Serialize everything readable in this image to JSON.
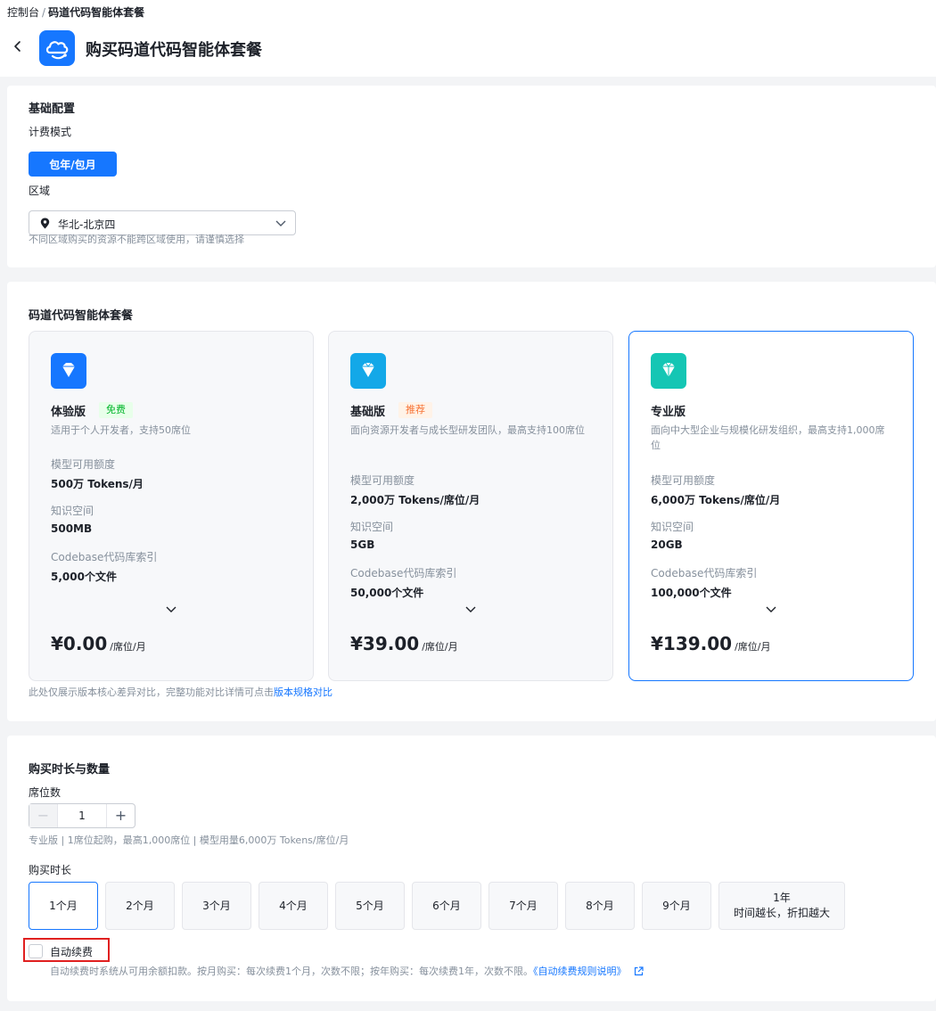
{
  "breadcrumb": {
    "root": "控制台",
    "sep": "/",
    "current": "码道代码智能体套餐"
  },
  "header": {
    "title": "购买码道代码智能体套餐"
  },
  "basic": {
    "title": "基础配置",
    "billing_label": "计费模式",
    "billing_value": "包年/包月",
    "region_label": "区域",
    "region_value": "华北-北京四",
    "region_hint": "不同区域购买的资源不能跨区域使用，请谨慎选择"
  },
  "plans_section": {
    "title": "码道代码智能体套餐",
    "compare_text": "此处仅展示版本核心差异对比，完整功能对比详情可点击",
    "compare_link": "版本规格对比",
    "plans": [
      {
        "name": "体验版",
        "badge": "免费",
        "desc": "适用于个人开发者，支持50席位",
        "k1": "模型可用额度",
        "v1": "500万 Tokens/月",
        "k2": "知识空间",
        "v2": "500MB",
        "k3": "Codebase代码库索引",
        "v3": "5,000个文件",
        "price": "¥0.00",
        "unit": "/席位/月",
        "icon_color": "#1677ff"
      },
      {
        "name": "基础版",
        "badge": "推荐",
        "desc": "面向资源开发者与成长型研发团队，最高支持100席位",
        "k1": "模型可用额度",
        "v1": "2,000万 Tokens/席位/月",
        "k2": "知识空间",
        "v2": "5GB",
        "k3": "Codebase代码库索引",
        "v3": "50,000个文件",
        "price": "¥39.00",
        "unit": "/席位/月",
        "icon_color": "#13a8e8"
      },
      {
        "name": "专业版",
        "badge": "",
        "desc": "面向中大型企业与规模化研发组织，最高支持1,000席位",
        "k1": "模型可用额度",
        "v1": "6,000万 Tokens/席位/月",
        "k2": "知识空间",
        "v2": "20GB",
        "k3": "Codebase代码库索引",
        "v3": "100,000个文件",
        "price": "¥139.00",
        "unit": "/席位/月",
        "icon_color": "#14c6b4"
      }
    ],
    "selected_plan": "专业版"
  },
  "purchase": {
    "title": "购买时长与数量",
    "seats_label": "席位数",
    "seats_value": "1",
    "seats_hint": "专业版 | 1席位起购，最高1,000席位 | 模型用量6,000万 Tokens/席位/月",
    "duration_label": "购买时长",
    "durations": [
      "1个月",
      "2个月",
      "3个月",
      "4个月",
      "5个月",
      "6个月",
      "7个月",
      "8个月",
      "9个月"
    ],
    "duration_year": "1年",
    "duration_year_note": "时间越长，折扣越大",
    "selected_duration": "1个月",
    "auto_renew_label": "自动续费",
    "auto_renew_checked": false,
    "auto_renew_hint": "自动续费时系统从可用余额扣款。按月购买：每次续费1个月，次数不限；按年购买：每次续费1年，次数不限。",
    "auto_renew_link": "《自动续费规则说明》"
  },
  "colors": {
    "accent": "#1677ff",
    "free_badge_bg": "#e8ffea",
    "free_badge_fg": "#00b42a",
    "rec_badge_bg": "#fff3e8",
    "rec_badge_fg": "#f77234",
    "highlight_border": "#e02020"
  }
}
